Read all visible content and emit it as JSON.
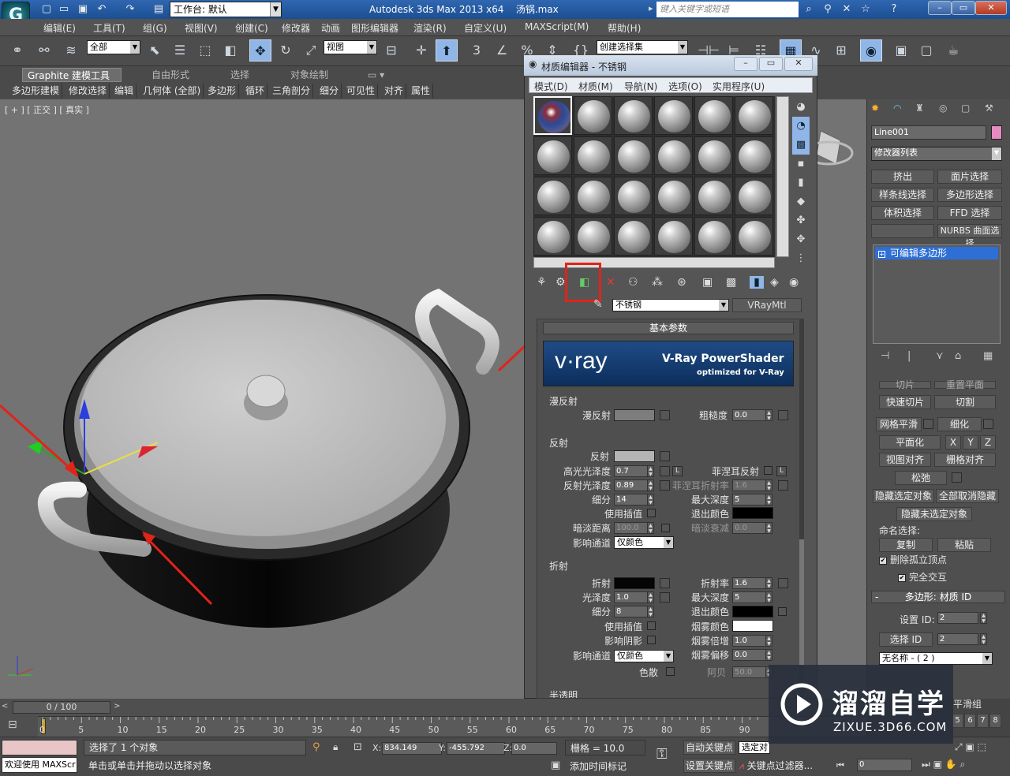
{
  "app": {
    "quick_workspace": "工作台: 默认",
    "title": "Autodesk 3ds Max  2013 x64",
    "file": "汤锅.max",
    "search_placeholder": "键入关键字或短语"
  },
  "menu": [
    "编辑(E)",
    "工具(T)",
    "组(G)",
    "视图(V)",
    "创建(C)",
    "修改器",
    "动画",
    "图形编辑器",
    "渲染(R)",
    "自定义(U)",
    "MAXScript(M)",
    "帮助(H)"
  ],
  "toolbar": {
    "selection_filter": "全部",
    "ref_coord": "视图",
    "named_selection": "创建选择集"
  },
  "ribbon": {
    "tabs": [
      "Graphite 建模工具",
      "自由形式",
      "选择",
      "对象绘制"
    ],
    "subtabs": [
      "多边形建模",
      "修改选择",
      "编辑",
      "几何体 (全部)",
      "多边形",
      "循环",
      "三角剖分",
      "细分",
      "可见性",
      "对齐",
      "属性"
    ]
  },
  "viewport": {
    "label": "[ + ] [ 正交 ] [ 真实 ]"
  },
  "material_editor": {
    "title": "材质编辑器 - 不锈钢",
    "menu": [
      "模式(D)",
      "材质(M)",
      "导航(N)",
      "选项(O)",
      "实用程序(U)"
    ],
    "material_name": "不锈钢",
    "material_type": "VRayMtl",
    "rollout_title": "基本参数",
    "banner_logo": "v·ray",
    "banner_title": "V-Ray PowerShader",
    "banner_sub": "optimized for V-Ray",
    "diffuse": {
      "group": "漫反射",
      "diffuse_label": "漫反射",
      "roughness_label": "粗糙度",
      "roughness": "0.0",
      "diffuse_color": "#7d7d7d"
    },
    "reflection": {
      "group": "反射",
      "reflect_label": "反射",
      "reflect_color": "#b4b4b4",
      "hilight_gloss_label": "高光光泽度",
      "hilight_gloss": "0.7",
      "lock": "L",
      "fresnel_label": "菲涅耳反射",
      "refl_gloss_label": "反射光泽度",
      "refl_gloss": "0.89",
      "fresnel_ior_label": "菲涅耳折射率",
      "fresnel_ior": "1.6",
      "subdivs_label": "细分",
      "subdivs": "14",
      "max_depth_label": "最大深度",
      "max_depth": "5",
      "use_interp_label": "使用插值",
      "exit_color_label": "退出颜色",
      "exit_color": "#000000",
      "dim_dist_label": "暗淡距离",
      "dim_dist": "100.0",
      "dim_falloff_label": "暗淡衰减",
      "dim_falloff": "0.0",
      "affect_channels_label": "影响通道",
      "affect_channels": "仅颜色"
    },
    "refraction": {
      "group": "折射",
      "refract_label": "折射",
      "refract_color": "#050505",
      "ior_label": "折射率",
      "ior": "1.6",
      "gloss_label": "光泽度",
      "gloss": "1.0",
      "max_depth_label": "最大深度",
      "max_depth": "5",
      "subdivs_label": "细分",
      "subdivs": "8",
      "exit_color_label": "退出颜色",
      "exit_color": "#000000",
      "use_interp_label": "使用插值",
      "fog_color_label": "烟雾颜色",
      "fog_color": "#ffffff",
      "affect_shadows_label": "影响阴影",
      "fog_mult_label": "烟雾倍增",
      "fog_mult": "1.0",
      "affect_channels_label": "影响通道",
      "affect_channels": "仅颜色",
      "fog_bias_label": "烟雾偏移",
      "fog_bias": "0.0",
      "dispersion_label": "色散",
      "abbe_label": "阿贝",
      "abbe": "50.0"
    },
    "translucency_partial": "半透明"
  },
  "command_panel": {
    "object_name": "Line001",
    "modifier_list": "修改器列表",
    "mod_buttons": [
      "挤出",
      "面片选择",
      "样条线选择",
      "多边形选择",
      "体积选择",
      "FFD 选择",
      "",
      "NURBS 曲面选择"
    ],
    "stack_item": "可编辑多边形",
    "cut_partial": "切片",
    "reset_plane_partial": "重置平面",
    "quickslice": "快速切片",
    "cut": "切割",
    "meshsmooth": "网格平滑",
    "tessellate": "细化",
    "make_planar": "平面化",
    "x": "X",
    "y": "Y",
    "z": "Z",
    "view_align": "视图对齐",
    "grid_align": "栅格对齐",
    "relax": "松弛",
    "hide_selected": "隐藏选定对象",
    "unhide_all": "全部取消隐藏",
    "hide_unselected": "隐藏未选定对象",
    "named_selections": "命名选择:",
    "copy": "复制",
    "paste": "粘贴",
    "delete_isolated": "删除孤立顶点",
    "full_interactivity": "完全交互",
    "matid_rollout": "多边形: 材质 ID",
    "set_id_label": "设置 ID:",
    "set_id": "2",
    "select_id_label": "选择 ID",
    "select_id": "2",
    "name_select": "无名称 - ( 2 )",
    "smoothing_partial": "平滑组",
    "sg_numbers": [
      "5",
      "6",
      "7",
      "8"
    ]
  },
  "timeline": {
    "frame": "0 / 100",
    "ticks": [
      "0",
      "5",
      "10",
      "15",
      "20",
      "25",
      "30",
      "35",
      "40",
      "45",
      "50",
      "55",
      "60",
      "65",
      "70",
      "75",
      "80",
      "85",
      "90"
    ]
  },
  "status": {
    "maxscript": "欢迎使用 MAXScr",
    "selected": "选择了 1 个对象",
    "prompt": "单击或单击并拖动以选择对象",
    "x_label": "X:",
    "x": "834.149",
    "y_label": "Y:",
    "y": "-455.792",
    "z_label": "Z:",
    "z": "0.0",
    "grid": "栅格 = 10.0",
    "add_time_tag": "添加时间标记",
    "auto_key": "自动关键点",
    "auto_key_sel": "选定对",
    "set_key": "设置关键点",
    "key_filters": "关键点过滤器...",
    "frame_field": "0"
  },
  "watermark": {
    "title": "溜溜自学",
    "url": "ZIXUE.3D66.COM"
  },
  "colors": {
    "highlight_red": "#e2231a",
    "accent_blue": "#2f67b0"
  }
}
